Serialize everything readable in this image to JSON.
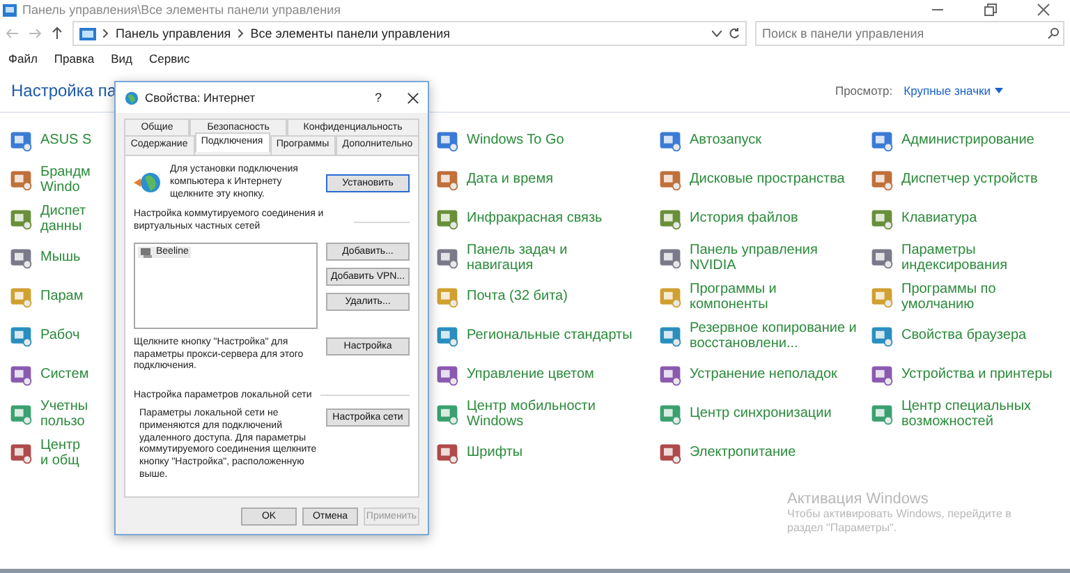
{
  "window": {
    "title": "Панель управления\\Все элементы панели управления"
  },
  "address": {
    "crumbs": [
      "Панель управления",
      "Все элементы панели управления"
    ]
  },
  "search": {
    "placeholder": "Поиск в панели управления"
  },
  "menu": [
    "Файл",
    "Правка",
    "Вид",
    "Сервис"
  ],
  "heading": "Настройка па",
  "view": {
    "label": "Просмотр:",
    "value": "Крупные значки"
  },
  "columns": [
    {
      "items": [
        "ASUS S",
        "Брандм\nWindo",
        "Диспет\nданны",
        "Мышь",
        "Парам",
        "Рабоч",
        "Систем",
        "Учетны\nпользо",
        "Центр\nи общ"
      ]
    },
    {
      "items": [
        "Windows To Go",
        "Дата и время",
        "Инфракрасная связь",
        "Панель задач и\nнавигация",
        "Почта (32 бита)",
        "Региональные стандарты",
        "Управление цветом",
        "Центр мобильности\nWindows",
        "Шрифты"
      ]
    },
    {
      "items": [
        "Автозапуск",
        "Дисковые пространства",
        "История файлов",
        "Панель управления\nNVIDIA",
        "Программы и\nкомпоненты",
        "Резервное копирование и\nвосстановлени...",
        "Устранение неполадок",
        "Центр синхронизации",
        "Электропитание"
      ]
    },
    {
      "items": [
        "Администрирование",
        "Диспетчер устройств",
        "Клавиатура",
        "Параметры\nиндексирования",
        "Программы по\nумолчанию",
        "Свойства браузера",
        "Устройства и принтеры",
        "Центр специальных\nвозможностей"
      ]
    }
  ],
  "dialog": {
    "title": "Свойства: Интернет",
    "help": "?",
    "tab_rows": [
      [
        {
          "label": "Общие",
          "selected": false
        },
        {
          "label": "Безопасность",
          "selected": false
        },
        {
          "label": "Конфиденциальность",
          "selected": false
        }
      ],
      [
        {
          "label": "Содержание",
          "selected": false
        },
        {
          "label": "Подключения",
          "selected": true
        },
        {
          "label": "Программы",
          "selected": false
        },
        {
          "label": "Дополнительно",
          "selected": false
        }
      ]
    ],
    "setup_text": "Для установки подключения компьютера к Интернету щелкните эту кнопку.",
    "setup_button": {
      "label": "Установить",
      "default": true
    },
    "dialup_group": "Настройка коммутируемого соединения и виртуальных частных сетей",
    "connections": [
      "Beeline"
    ],
    "side_buttons": [
      "Добавить...",
      "Добавить VPN...",
      "Удалить..."
    ],
    "proxy_text": "Щелкните кнопку \"Настройка\" для параметры прокси-сервера для этого подключения.",
    "proxy_button": "Настройка",
    "lan_group": "Настройка параметров локальной сети",
    "lan_text": "Параметры локальной сети не применяются для подключений удаленного доступа. Для параметры коммутируемого соединения щелкните кнопку \"Настройка\", расположенную выше.",
    "lan_button": "Настройка сети",
    "footer_buttons": [
      {
        "label": "OK",
        "disabled": false
      },
      {
        "label": "Отмена",
        "disabled": false
      },
      {
        "label": "Применить",
        "disabled": true
      }
    ]
  },
  "activation": {
    "title": "Активация Windows",
    "text": "Чтобы активировать Windows, перейдите в раздел \"Параметры\"."
  }
}
